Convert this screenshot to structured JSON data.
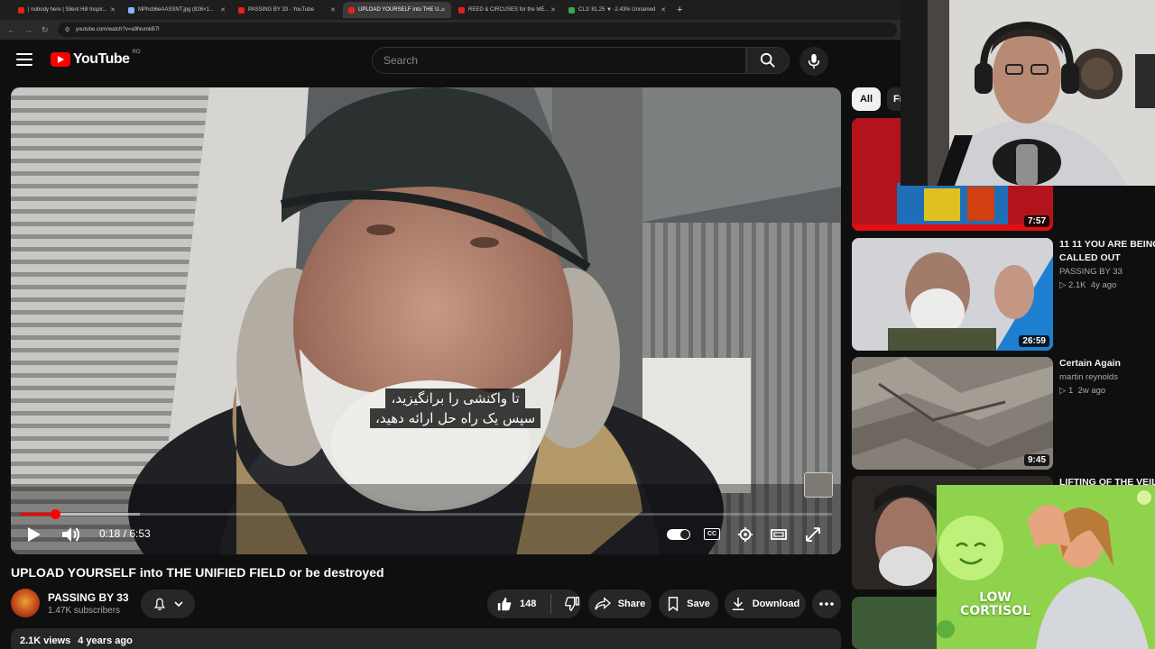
{
  "browser": {
    "tabs": [
      {
        "title": "| nobody here | Silent Hill Inspir...",
        "active": false
      },
      {
        "title": "MPhcb6eAASSNT.jpg (826×1...",
        "active": false
      },
      {
        "title": "PASSING BY 33 - YouTube",
        "active": false
      },
      {
        "title": "UPLOAD YOURSELF into THE U...",
        "active": true
      },
      {
        "title": "REED & CIRCUSES for the ME...",
        "active": false
      },
      {
        "title": "CL1! 81.25 ▼ -2.43% Unnamed",
        "active": false
      }
    ],
    "url": "youtube.com/watch?v=a9NumkB7I"
  },
  "header": {
    "logo_text": "YouTube",
    "logo_superscript": "RO",
    "search_placeholder": "Search"
  },
  "player": {
    "subtitle_line1": "تا واکنشی را برانگیزید،",
    "subtitle_line2": "سپس یک راه حل ارائه دهید،",
    "current_time": "0:18",
    "duration": "6:53",
    "time_display": "0:18 / 6:53",
    "played_fraction": 0.0436,
    "buffered_fraction": 0.148,
    "cc_label": "CC"
  },
  "video": {
    "title": "UPLOAD YOURSELF into THE UNIFIED FIELD or be destroyed",
    "channel_name": "PASSING BY 33",
    "subscribers": "1.47K subscribers",
    "like_count": "148",
    "share_label": "Share",
    "save_label": "Save",
    "download_label": "Download",
    "views": "2.1K views",
    "age": "4 years ago"
  },
  "related": {
    "chips": [
      "All",
      "Fr"
    ],
    "items": [
      {
        "duration": "7:57",
        "title_line1": "",
        "title_line2": "",
        "channel": "",
        "meta": ""
      },
      {
        "duration": "26:59",
        "title_line1": "11 11 YOU ARE BEING",
        "title_line2": "CALLED OUT",
        "channel": "PASSING BY 33",
        "views": "2.1K",
        "age": "4y ago"
      },
      {
        "duration": "9:45",
        "title_line1": "Certain Again",
        "title_line2": "",
        "channel": "martin reynolds",
        "views": "1",
        "age": "2w ago"
      },
      {
        "duration": "",
        "title_line1": "LIFTING OF THE VEIL",
        "title_line2": "",
        "channel": "",
        "meta": ""
      }
    ]
  },
  "overlay_ad": {
    "text_line1": "LOW",
    "text_line2": "CORTISOL"
  },
  "colors": {
    "background": "#0f0f0f",
    "accent_red": "#ff0000",
    "pill_bg": "#272727"
  }
}
